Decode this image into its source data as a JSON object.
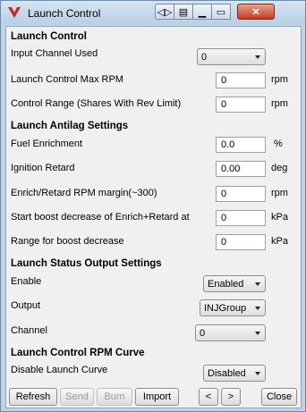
{
  "window": {
    "title": "Launch Control"
  },
  "titlebar_buttons": [
    {
      "icon": "navigate-icon",
      "glyph": "◁▷"
    },
    {
      "icon": "document-icon",
      "glyph": "▤"
    },
    {
      "icon": "minimize-icon",
      "glyph": "▁"
    },
    {
      "icon": "maximize-icon",
      "glyph": "▭"
    },
    {
      "icon": "close-icon",
      "glyph": "✕"
    }
  ],
  "sections": {
    "launch_control": "Launch Control",
    "antilag": "Launch Antilag Settings",
    "status_output": "Launch Status Output Settings",
    "rpm_curve": "Launch Control RPM Curve"
  },
  "fields": {
    "input_channel": {
      "label": "Input Channel Used",
      "value": "0"
    },
    "max_rpm": {
      "label": "Launch Control Max RPM",
      "value": "0",
      "unit": "rpm"
    },
    "control_range": {
      "label": "Control Range (Shares With Rev Limit)",
      "value": "0",
      "unit": "rpm"
    },
    "fuel_enrichment": {
      "label": "Fuel Enrichment",
      "value": "0.0",
      "unit": "%"
    },
    "ignition_retard": {
      "label": "Ignition Retard",
      "value": "0.00",
      "unit": "deg"
    },
    "enrich_margin": {
      "label": "Enrich/Retard RPM margin(~300)",
      "value": "0",
      "unit": "rpm"
    },
    "boost_start": {
      "label": "Start boost decrease of Enrich+Retard at",
      "value": "0",
      "unit": "kPa"
    },
    "boost_range": {
      "label": "Range for boost decrease",
      "value": "0",
      "unit": "kPa"
    },
    "enable": {
      "label": "Enable",
      "value": "Enabled"
    },
    "output": {
      "label": "Output",
      "value": "INJGroup"
    },
    "channel": {
      "label": "Channel",
      "value": "0"
    },
    "disable_curve": {
      "label": "Disable Launch Curve",
      "value": "Disabled"
    }
  },
  "buttons": {
    "refresh": "Refresh",
    "send": "Send",
    "burn": "Burn",
    "import": "Import",
    "prev": "<",
    "next": ">",
    "close": "Close"
  },
  "colors": {
    "accent": "#c43c23",
    "frame": "#bfd2e6"
  }
}
